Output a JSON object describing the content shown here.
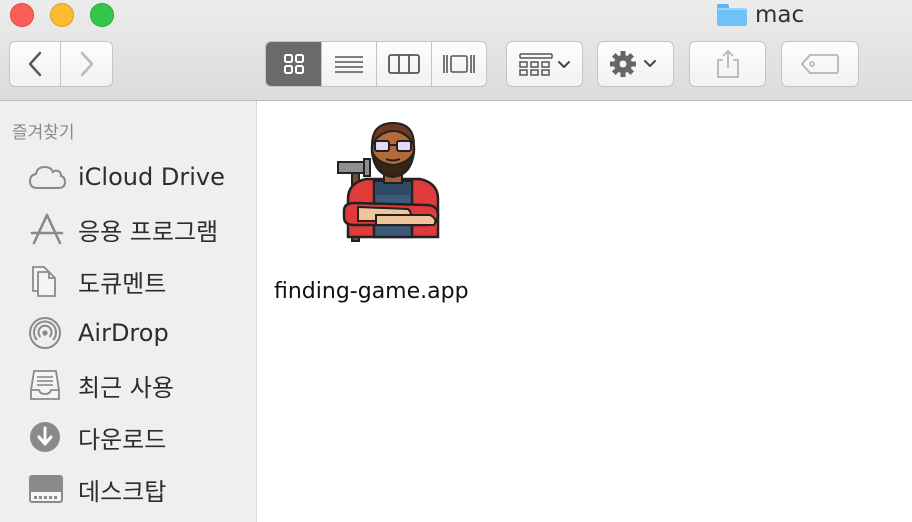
{
  "window": {
    "title": "mac",
    "icon": "folder-icon"
  },
  "toolbar": {
    "traffic_lights": [
      "close",
      "minimize",
      "maximize"
    ],
    "nav": [
      "back-icon",
      "forward-icon"
    ],
    "view_modes": [
      "icon-view",
      "list-view",
      "column-view",
      "gallery-view"
    ],
    "active_view": "icon-view",
    "arrange_icon": "arrange-icon",
    "action_icon": "gear-icon",
    "share_icon": "share-icon",
    "tag_icon": "tag-icon"
  },
  "sidebar": {
    "header": "즐겨찾기",
    "items": [
      {
        "label": "iCloud Drive",
        "icon": "cloud-icon"
      },
      {
        "label": "응용 프로그램",
        "icon": "applications-icon"
      },
      {
        "label": "도큐멘트",
        "icon": "documents-icon"
      },
      {
        "label": "AirDrop",
        "icon": "airdrop-icon"
      },
      {
        "label": "최근 사용",
        "icon": "recents-icon"
      },
      {
        "label": "다운로드",
        "icon": "downloads-icon"
      },
      {
        "label": "데스크탑",
        "icon": "desktop-icon"
      }
    ]
  },
  "main": {
    "files": [
      {
        "name": "finding-game.app",
        "icon": "app-icon-carpenter"
      }
    ]
  },
  "colors": {
    "close": "#fc5d57",
    "minimize": "#fdbc2f",
    "maximize": "#34c84a",
    "folder": "#6ec2f6",
    "sidebar_bg": "#efefef",
    "active_segment": "#6a6a6a"
  }
}
